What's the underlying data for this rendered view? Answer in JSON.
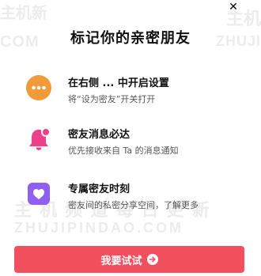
{
  "watermark": {
    "cn_small": "主机新",
    "en_small": "COM",
    "cn_right": "主机",
    "en_right": "ZHUJI",
    "cn_mid": "主 机 频 道   每 日 更 新",
    "en_mid": "ZHUJIPINDAO.COM"
  },
  "dialog": {
    "close_glyph": "✕",
    "title": "标记你的亲密朋友"
  },
  "features": [
    {
      "title": "在右侧 ... 中开启设置",
      "desc": "将“设为密友”开关打开",
      "icon": "more-dots-icon",
      "color": "#f09a39"
    },
    {
      "title": "密友消息必达",
      "desc": "优先接收来自 Ta 的消息通知",
      "icon": "bell-icon",
      "color": "#ee3f89"
    },
    {
      "title": "专属密友时刻",
      "desc": "密友间的私密分享空间，了解更多",
      "icon": "heart-icon",
      "color": "#8f5ef2"
    }
  ],
  "cta": {
    "label": "我要试试",
    "icon": "arrow-right-circle-icon",
    "color": "#f24f5f"
  }
}
